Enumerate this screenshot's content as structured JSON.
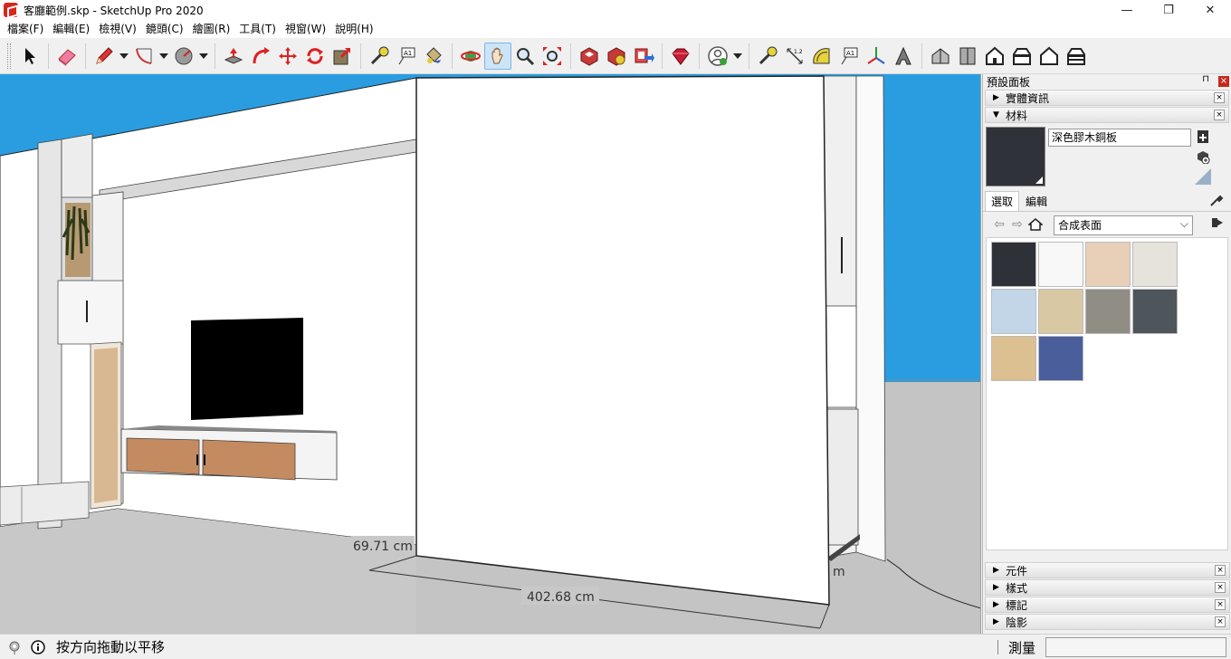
{
  "window": {
    "title": "客廳範例.skp - SketchUp Pro 2020",
    "minimize": "—",
    "maximize": "❐",
    "close": "✕"
  },
  "menu": [
    "檔案(F)",
    "編輯(E)",
    "檢視(V)",
    "鏡頭(C)",
    "繪圖(R)",
    "工具(T)",
    "視窗(W)",
    "說明(H)"
  ],
  "toolbar": {
    "active_tool": "pan-tool",
    "tools": [
      "select",
      "eraser",
      "line",
      "arc",
      "shape",
      "push-pull",
      "follow-me",
      "move",
      "rotate",
      "scale",
      "tape-measure",
      "text",
      "paint-bucket",
      "orbit",
      "pan",
      "zoom",
      "zoom-extents",
      "3d-warehouse",
      "extension-warehouse",
      "layout",
      "extension-manager",
      "account",
      "dimension",
      "protractor",
      "axes",
      "3d-text",
      "iso",
      "top",
      "front",
      "right",
      "back",
      "left"
    ]
  },
  "viewport": {
    "dim_small": "69.71 cm",
    "dim_main": "402.68 cm",
    "dim_edge": "m"
  },
  "panel": {
    "title": "預設面板",
    "pin": "⊓",
    "close": "×",
    "entity_info": "實體資訊",
    "materials": "材料",
    "material_name": "深色膠木銅板",
    "tab_select": "選取",
    "tab_edit": "編輯",
    "library": "合成表面",
    "components": "元件",
    "styles": "樣式",
    "tags": "標記",
    "shadows": "陰影",
    "tray_close": "×"
  },
  "swatches": [
    "#2e3238",
    "#f8f8f8",
    "#e8cfb8",
    "#e6e3dc",
    "#c2d6e8",
    "#d8c8a4",
    "#908e84",
    "#4e565c",
    "#dcc092",
    "#4a5e9c"
  ],
  "status": {
    "message": "按方向拖動以平移",
    "measure_label": "測量"
  }
}
